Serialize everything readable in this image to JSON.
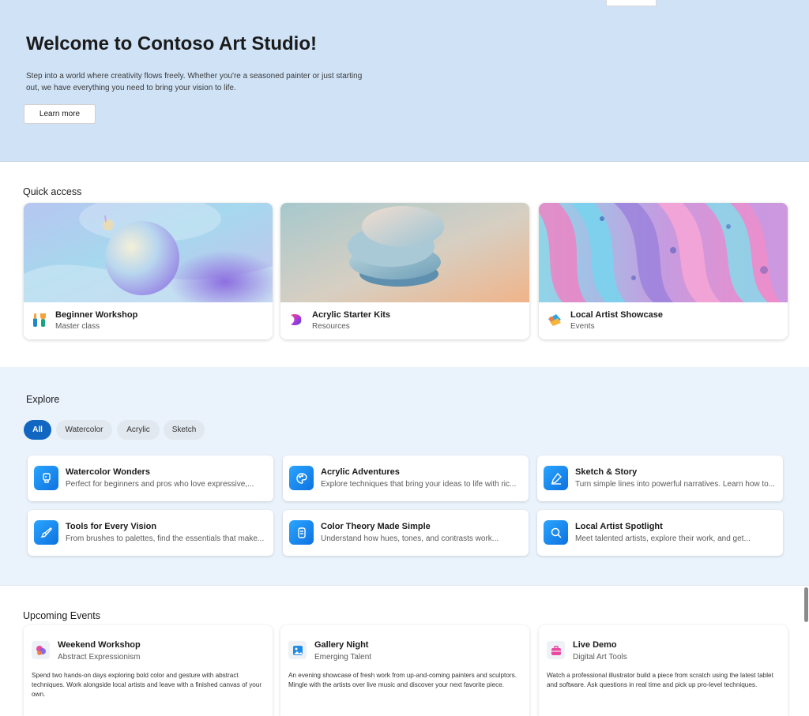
{
  "hero": {
    "title": "Welcome to Contoso Art Studio!",
    "description": "Step into a world where creativity flows freely. Whether you're a seasoned painter or just starting out, we have everything you need to bring your vision to life.",
    "learn_more": "Learn more"
  },
  "quick_access": {
    "title": "Quick access",
    "cards": [
      {
        "title": "Beginner Workshop",
        "subtitle": "Master class",
        "icon": "paint-tools-icon"
      },
      {
        "title": "Acrylic Starter Kits",
        "subtitle": "Resources",
        "icon": "designer-logo-icon"
      },
      {
        "title": "Local Artist Showcase",
        "subtitle": "Events",
        "icon": "whiteboard-icon"
      }
    ]
  },
  "explore": {
    "title": "Explore",
    "chips": [
      "All",
      "Watercolor",
      "Acrylic",
      "Sketch"
    ],
    "active_chip": "All",
    "cards": [
      {
        "title": "Watercolor Wonders",
        "desc": "Perfect for beginners and pros who love expressive,...",
        "icon": "paint-bucket-icon"
      },
      {
        "title": "Acrylic Adventures",
        "desc": "Explore techniques that bring your ideas to life with ric...",
        "icon": "palette-icon"
      },
      {
        "title": "Sketch & Story",
        "desc": "Turn simple lines into powerful narratives. Learn how to...",
        "icon": "pen-sign-icon"
      },
      {
        "title": "Tools for Every Vision",
        "desc": "From brushes to palettes, find the essentials that make...",
        "icon": "brush-icon"
      },
      {
        "title": "Color Theory Made Simple",
        "desc": "Understand how hues, tones, and contrasts work...",
        "icon": "color-swatch-icon"
      },
      {
        "title": "Local Artist Spotlight",
        "desc": "Meet talented artists, explore their work, and get...",
        "icon": "search-icon"
      }
    ]
  },
  "events": {
    "title": "Upcoming Events",
    "cards": [
      {
        "title": "Weekend Workshop",
        "subtitle": "Abstract Expressionism",
        "desc": "Spend two hands-on days exploring bold color and gesture with abstract techniques. Work alongside local artists and leave with a finished canvas of your own.",
        "icon": "paint-blob-icon"
      },
      {
        "title": "Gallery Night",
        "subtitle": "Emerging Talent",
        "desc": "An evening showcase of fresh work from up-and-coming painters and sculptors. Mingle with the artists over live music and discover your next favorite piece.",
        "icon": "image-icon"
      },
      {
        "title": "Live Demo",
        "subtitle": "Digital Art Tools",
        "desc": "Watch a professional illustrator build a piece from scratch using the latest tablet and software. Ask questions in real time and pick up pro-level techniques.",
        "icon": "toolbox-icon"
      }
    ]
  },
  "colors": {
    "hero_bg": "#cfe2f6",
    "explore_bg": "#eaf2fc",
    "accent": "#1166c2"
  }
}
